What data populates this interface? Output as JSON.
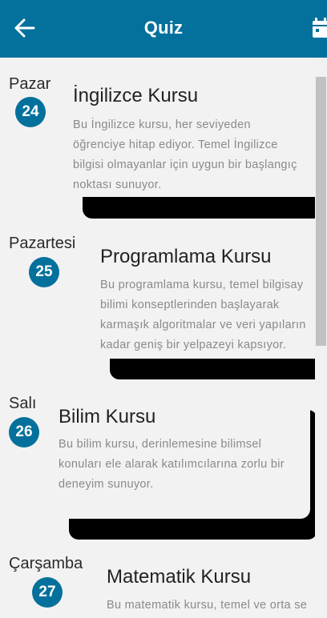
{
  "header": {
    "title": "Quiz",
    "back_icon": "arrow-left-icon",
    "calendar_icon": "calendar-icon",
    "color": "#04709c"
  },
  "courses": [
    {
      "day": "Pazar",
      "date": "24",
      "title": "İngilizce Kursu",
      "description": "Bu İngilizce kursu, her seviyeden\nöğrenciye hitap ediyor. Temel İngilizce\nbilgisi olmayanlar için uygun bir başlangıç\nnoktası sunuyor."
    },
    {
      "day": "Pazartesi",
      "date": "25",
      "title": "Programlama Kursu",
      "description": "Bu programlama kursu, temel bilgisay\nbilimi konseptlerinden başlayarak\nkarmaşık algoritmalar ve veri yapıların\nkadar geniş bir yelpazeyi kapsıyor."
    },
    {
      "day": "Salı",
      "date": "26",
      "title": "Bilim Kursu",
      "description": "Bu bilim kursu, derinlemesine bilimsel\nkonuları ele alarak katılımcılarına zorlu bir\ndeneyim sunuyor."
    },
    {
      "day": "Çarşamba",
      "date": "27",
      "title": "Matematik Kursu",
      "description": "Bu matematik kursu, temel ve orta se"
    }
  ]
}
